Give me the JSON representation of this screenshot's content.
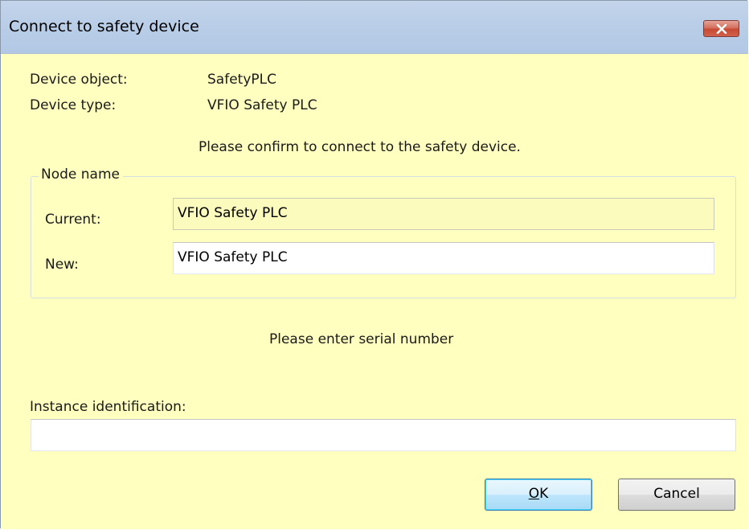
{
  "dialog": {
    "title": "Connect to safety device"
  },
  "device": {
    "object_label": "Device object:",
    "object_value": "SafetyPLC",
    "type_label": "Device type:",
    "type_value": "VFIO Safety PLC"
  },
  "confirm_message": "Please confirm to connect to the safety device.",
  "node_name": {
    "group_label": "Node name",
    "current_label": "Current:",
    "current_value": "VFIO Safety PLC",
    "new_label": "New:",
    "new_value": "VFIO Safety PLC"
  },
  "serial_prompt": "Please enter serial number",
  "instance": {
    "label": "Instance identification:",
    "value": ""
  },
  "buttons": {
    "ok_accel": "O",
    "ok_rest": "K",
    "cancel": "Cancel"
  },
  "colors": {
    "dialog_background": "#ffffc0",
    "titlebar": "#b9cde7",
    "close_button": "#c74a34"
  },
  "icons": {
    "close": "close-icon"
  }
}
